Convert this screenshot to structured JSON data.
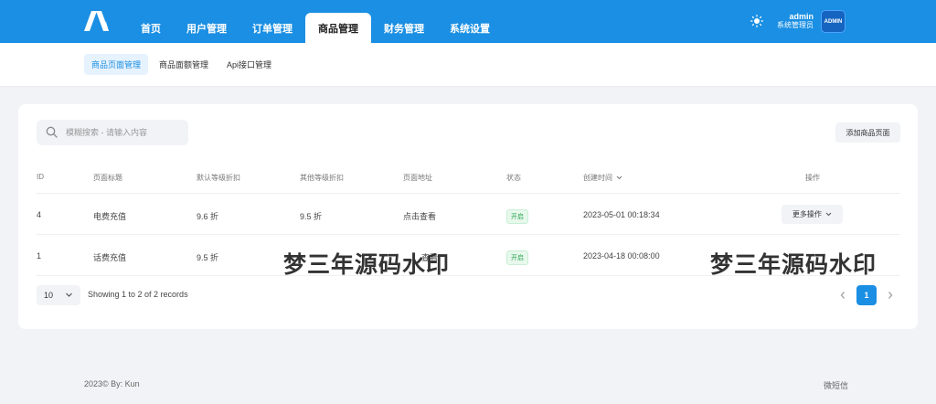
{
  "nav": {
    "items": [
      "首页",
      "用户管理",
      "订单管理",
      "商品管理",
      "财务管理",
      "系统设置"
    ],
    "active_index": 3
  },
  "user": {
    "name": "admin",
    "role": "系统管理员",
    "avatar_text": "ADMIN"
  },
  "subnav": {
    "items": [
      "商品页面管理",
      "商品面额管理",
      "Api接口管理"
    ],
    "active_index": 0
  },
  "search": {
    "placeholder": "模糊搜索 - 请输入内容",
    "value": ""
  },
  "toolbar": {
    "add_label": "添加商品页面"
  },
  "table": {
    "headers": [
      "ID",
      "页面标题",
      "默认等级折扣",
      "其他等级折扣",
      "页面地址",
      "状态",
      "创建时间",
      "操作"
    ],
    "sort_column": "创建时间",
    "rows": [
      {
        "id": "4",
        "title": "电费充值",
        "default_discount": "9.6 折",
        "other_discount": "9.5 折",
        "address": "点击查看",
        "status": "开启",
        "created": "2023-05-01 00:18:34",
        "action": "更多操作"
      },
      {
        "id": "1",
        "title": "话费充值",
        "default_discount": "9.5 折",
        "other_discount": "",
        "address": "查看",
        "status": "开启",
        "created": "2023-04-18 00:08:00",
        "action": ""
      }
    ]
  },
  "pagination": {
    "page_size": "10",
    "summary": "Showing 1 to 2 of 2 records",
    "current_page": "1"
  },
  "watermark": "梦三年源码水印",
  "footer": {
    "left": "2023© By: Kun",
    "right": "微短信"
  },
  "colors": {
    "primary": "#1a8fe3",
    "success": "#2aa44f",
    "background": "#f1f3f6"
  }
}
